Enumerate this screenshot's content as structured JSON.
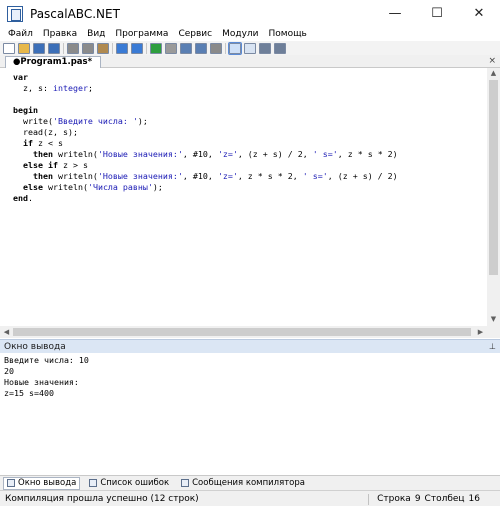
{
  "window": {
    "title": "PascalABC.NET",
    "minimize": "—",
    "maximize": "☐",
    "close": "✕"
  },
  "menu": [
    "Файл",
    "Правка",
    "Вид",
    "Программа",
    "Сервис",
    "Модули",
    "Помощь"
  ],
  "toolbar": {
    "buttons": [
      "new-file-icon",
      "open-icon",
      "save-icon",
      "save-all-icon",
      "cut-icon",
      "copy-icon",
      "paste-icon",
      "undo-icon",
      "redo-icon",
      "run-icon",
      "stop-icon",
      "debug-icon",
      "step-icon",
      "pause-icon",
      "layout-icon",
      "form-icon",
      "toggle-output-icon",
      "window-icon"
    ],
    "active_button": 14
  },
  "editor": {
    "tab_label": "●Program1.pas*",
    "tab_close": "×",
    "code": [
      "var",
      "  z, s: integer;",
      "",
      "begin",
      "  write('Введите числа: ');",
      "  read(z, s);",
      "  if z < s",
      "    then writeln('Новые значения:', #10, 'z=', (z + s) / 2, ' s=', z * s * 2)",
      "  else if z > s",
      "    then writeln('Новые значения:', #10, 'z=', z * s * 2, ' s=', (z + s) / 2)",
      "  else writeln('Числа равны');",
      "end."
    ]
  },
  "output": {
    "title": "Окно вывода",
    "pin": "⊥",
    "lines": [
      "Введите числа: 10",
      "20",
      "Новые значения:",
      "z=15 s=400"
    ]
  },
  "bottom_tabs": [
    {
      "label": "Окно вывода",
      "active": true
    },
    {
      "label": "Список ошибок",
      "active": false
    },
    {
      "label": "Сообщения компилятора",
      "active": false
    }
  ],
  "status": {
    "message": "Компиляция прошла успешно (12 строк)",
    "row_label": "Строка",
    "row_value": "9",
    "col_label": "Столбец",
    "col_value": "16"
  },
  "colors": {
    "keyword": "#000000",
    "string": "#1b1bb5",
    "output_header": "#dbe6f4"
  }
}
